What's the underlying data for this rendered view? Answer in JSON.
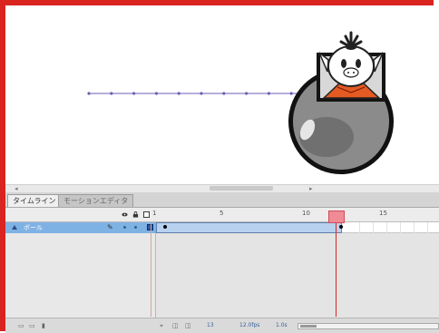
{
  "colors": {
    "frame_border": "#d9241f",
    "layer_selected": "#7fb2e4",
    "tween_fill": "#b8d1ee",
    "playhead": "#ef8b95",
    "motion_path": "#6b5fb5",
    "ball": "#8a8a8a"
  },
  "stage": {
    "motion_path_dots": 11
  },
  "timeline": {
    "tabs": [
      {
        "label": "タイムライン"
      },
      {
        "label": "モーションエディタ"
      }
    ],
    "header_icons": [
      "eye-icon",
      "lock-icon",
      "outline-icon"
    ],
    "frame_numbers": [
      "1",
      "5",
      "10",
      "15"
    ],
    "layer": {
      "name": "ボール",
      "icon": "layer-icon",
      "tool_icon": "pencil-icon"
    },
    "bottom_bar": {
      "icons": [
        "new-layer-icon",
        "new-folder-icon",
        "delete-icon",
        "center-frame-icon",
        "onion-skin-icon",
        "edit-multiple-frames-icon"
      ],
      "current_frame": "13",
      "frame_rate": "12.0fps",
      "elapsed": "1.0s"
    }
  }
}
